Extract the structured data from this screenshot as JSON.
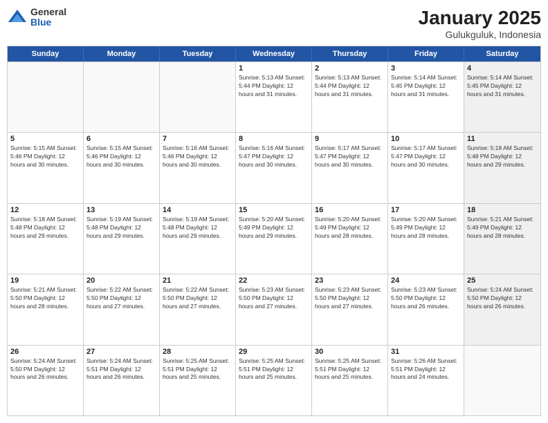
{
  "logo": {
    "general": "General",
    "blue": "Blue"
  },
  "title": "January 2025",
  "subtitle": "Gulukguluk, Indonesia",
  "header": {
    "days": [
      "Sunday",
      "Monday",
      "Tuesday",
      "Wednesday",
      "Thursday",
      "Friday",
      "Saturday"
    ]
  },
  "weeks": [
    [
      {
        "day": "",
        "info": "",
        "empty": true
      },
      {
        "day": "",
        "info": "",
        "empty": true
      },
      {
        "day": "",
        "info": "",
        "empty": true
      },
      {
        "day": "1",
        "info": "Sunrise: 5:13 AM\nSunset: 5:44 PM\nDaylight: 12 hours\nand 31 minutes."
      },
      {
        "day": "2",
        "info": "Sunrise: 5:13 AM\nSunset: 5:44 PM\nDaylight: 12 hours\nand 31 minutes."
      },
      {
        "day": "3",
        "info": "Sunrise: 5:14 AM\nSunset: 5:45 PM\nDaylight: 12 hours\nand 31 minutes."
      },
      {
        "day": "4",
        "info": "Sunrise: 5:14 AM\nSunset: 5:45 PM\nDaylight: 12 hours\nand 31 minutes."
      }
    ],
    [
      {
        "day": "5",
        "info": "Sunrise: 5:15 AM\nSunset: 5:46 PM\nDaylight: 12 hours\nand 30 minutes."
      },
      {
        "day": "6",
        "info": "Sunrise: 5:15 AM\nSunset: 5:46 PM\nDaylight: 12 hours\nand 30 minutes."
      },
      {
        "day": "7",
        "info": "Sunrise: 5:16 AM\nSunset: 5:46 PM\nDaylight: 12 hours\nand 30 minutes."
      },
      {
        "day": "8",
        "info": "Sunrise: 5:16 AM\nSunset: 5:47 PM\nDaylight: 12 hours\nand 30 minutes."
      },
      {
        "day": "9",
        "info": "Sunrise: 5:17 AM\nSunset: 5:47 PM\nDaylight: 12 hours\nand 30 minutes."
      },
      {
        "day": "10",
        "info": "Sunrise: 5:17 AM\nSunset: 5:47 PM\nDaylight: 12 hours\nand 30 minutes."
      },
      {
        "day": "11",
        "info": "Sunrise: 5:18 AM\nSunset: 5:48 PM\nDaylight: 12 hours\nand 29 minutes."
      }
    ],
    [
      {
        "day": "12",
        "info": "Sunrise: 5:18 AM\nSunset: 5:48 PM\nDaylight: 12 hours\nand 29 minutes."
      },
      {
        "day": "13",
        "info": "Sunrise: 5:19 AM\nSunset: 5:48 PM\nDaylight: 12 hours\nand 29 minutes."
      },
      {
        "day": "14",
        "info": "Sunrise: 5:19 AM\nSunset: 5:48 PM\nDaylight: 12 hours\nand 29 minutes."
      },
      {
        "day": "15",
        "info": "Sunrise: 5:20 AM\nSunset: 5:49 PM\nDaylight: 12 hours\nand 29 minutes."
      },
      {
        "day": "16",
        "info": "Sunrise: 5:20 AM\nSunset: 5:49 PM\nDaylight: 12 hours\nand 28 minutes."
      },
      {
        "day": "17",
        "info": "Sunrise: 5:20 AM\nSunset: 5:49 PM\nDaylight: 12 hours\nand 28 minutes."
      },
      {
        "day": "18",
        "info": "Sunrise: 5:21 AM\nSunset: 5:49 PM\nDaylight: 12 hours\nand 28 minutes."
      }
    ],
    [
      {
        "day": "19",
        "info": "Sunrise: 5:21 AM\nSunset: 5:50 PM\nDaylight: 12 hours\nand 28 minutes."
      },
      {
        "day": "20",
        "info": "Sunrise: 5:22 AM\nSunset: 5:50 PM\nDaylight: 12 hours\nand 27 minutes."
      },
      {
        "day": "21",
        "info": "Sunrise: 5:22 AM\nSunset: 5:50 PM\nDaylight: 12 hours\nand 27 minutes."
      },
      {
        "day": "22",
        "info": "Sunrise: 5:23 AM\nSunset: 5:50 PM\nDaylight: 12 hours\nand 27 minutes."
      },
      {
        "day": "23",
        "info": "Sunrise: 5:23 AM\nSunset: 5:50 PM\nDaylight: 12 hours\nand 27 minutes."
      },
      {
        "day": "24",
        "info": "Sunrise: 5:23 AM\nSunset: 5:50 PM\nDaylight: 12 hours\nand 26 minutes."
      },
      {
        "day": "25",
        "info": "Sunrise: 5:24 AM\nSunset: 5:50 PM\nDaylight: 12 hours\nand 26 minutes."
      }
    ],
    [
      {
        "day": "26",
        "info": "Sunrise: 5:24 AM\nSunset: 5:50 PM\nDaylight: 12 hours\nand 26 minutes."
      },
      {
        "day": "27",
        "info": "Sunrise: 5:24 AM\nSunset: 5:51 PM\nDaylight: 12 hours\nand 26 minutes."
      },
      {
        "day": "28",
        "info": "Sunrise: 5:25 AM\nSunset: 5:51 PM\nDaylight: 12 hours\nand 25 minutes."
      },
      {
        "day": "29",
        "info": "Sunrise: 5:25 AM\nSunset: 5:51 PM\nDaylight: 12 hours\nand 25 minutes."
      },
      {
        "day": "30",
        "info": "Sunrise: 5:25 AM\nSunset: 5:51 PM\nDaylight: 12 hours\nand 25 minutes."
      },
      {
        "day": "31",
        "info": "Sunrise: 5:26 AM\nSunset: 5:51 PM\nDaylight: 12 hours\nand 24 minutes."
      },
      {
        "day": "",
        "info": "",
        "empty": true
      }
    ]
  ]
}
